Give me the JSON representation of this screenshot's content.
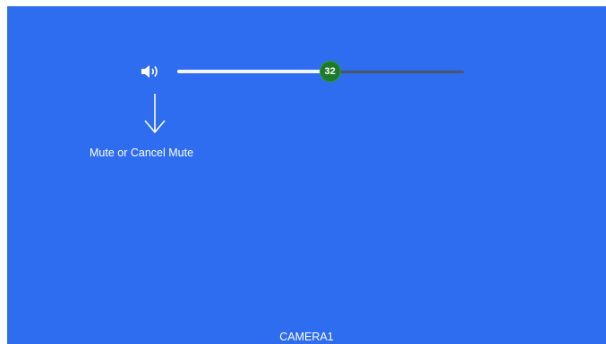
{
  "volume": {
    "icon": "speaker-icon",
    "value": 32,
    "max": 60
  },
  "hint": {
    "icon": "arrow-down-icon",
    "text": "Mute or Cancel Mute"
  },
  "camera": {
    "name": "CAMERA1"
  },
  "colors": {
    "background": "#2e6df0",
    "thumb": "#1e7a2a",
    "track_filled": "#f2f5fb",
    "track_rest": "#4a5566"
  }
}
